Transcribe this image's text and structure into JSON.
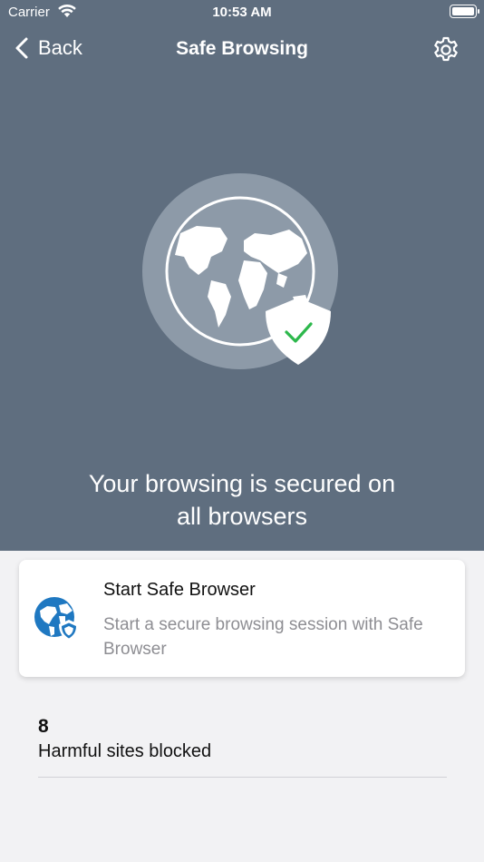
{
  "status_bar": {
    "carrier": "Carrier",
    "time": "10:53 AM"
  },
  "nav": {
    "back_label": "Back",
    "title": "Safe Browsing"
  },
  "hero": {
    "message_line1": "Your browsing is secured on",
    "message_line2": "all browsers"
  },
  "card": {
    "title": "Start Safe Browser",
    "subtitle": "Start a secure browsing session with Safe Browser"
  },
  "stats": {
    "blocked_count": "8",
    "blocked_label": "Harmful sites blocked"
  },
  "colors": {
    "hero_bg": "#5f6e7f",
    "check_green": "#2db84c",
    "accent_blue": "#1f78c1",
    "page_bg": "#f2f2f4"
  },
  "icons": [
    "wifi-icon",
    "battery-icon",
    "back-chevron-icon",
    "gear-icon",
    "globe-shield-icon",
    "checkmark-icon",
    "safe-browser-icon"
  ]
}
